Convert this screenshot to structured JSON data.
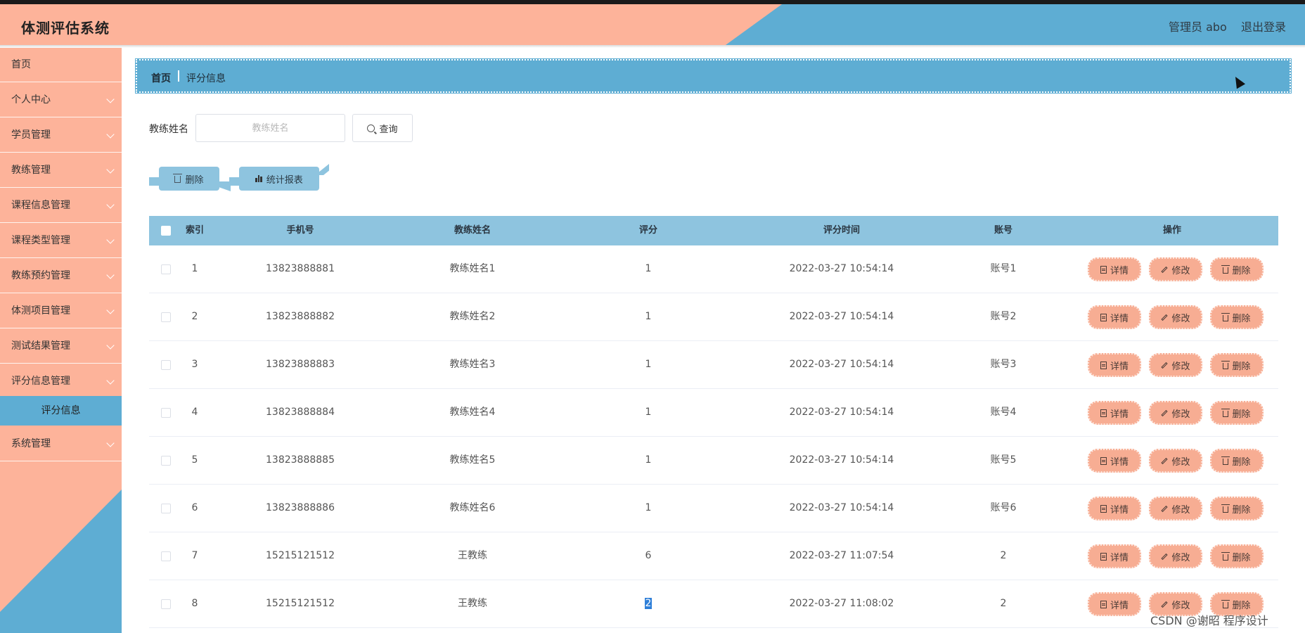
{
  "app": {
    "title": "体测评估系统"
  },
  "header": {
    "admin_label": "管理员 abo",
    "logout_label": "退出登录"
  },
  "sidebar": {
    "items": [
      {
        "label": "首页",
        "has_children": false
      },
      {
        "label": "个人中心",
        "has_children": true
      },
      {
        "label": "学员管理",
        "has_children": true
      },
      {
        "label": "教练管理",
        "has_children": true
      },
      {
        "label": "课程信息管理",
        "has_children": true
      },
      {
        "label": "课程类型管理",
        "has_children": true
      },
      {
        "label": "教练预约管理",
        "has_children": true
      },
      {
        "label": "体测项目管理",
        "has_children": true
      },
      {
        "label": "测试结果管理",
        "has_children": true
      },
      {
        "label": "评分信息管理",
        "has_children": true
      },
      {
        "label": "评分信息",
        "active_sub": true
      },
      {
        "label": "系统管理",
        "has_children": true
      }
    ]
  },
  "breadcrumb": {
    "home": "首页",
    "current": "评分信息"
  },
  "search": {
    "label": "教练姓名",
    "placeholder": "教练姓名",
    "value": "",
    "button_label": "查询"
  },
  "toolbar": {
    "delete_label": "删除",
    "report_label": "统计报表"
  },
  "table": {
    "headers": {
      "index": "索引",
      "phone": "手机号",
      "coach": "教练姓名",
      "score": "评分",
      "time": "评分时间",
      "account": "账号",
      "ops": "操作"
    },
    "actions": {
      "detail": "详情",
      "edit": "修改",
      "delete": "删除"
    },
    "rows": [
      {
        "index": "1",
        "phone": "13823888881",
        "coach": "教练姓名1",
        "score": "1",
        "time": "2022-03-27 10:54:14",
        "account": "账号1"
      },
      {
        "index": "2",
        "phone": "13823888882",
        "coach": "教练姓名2",
        "score": "1",
        "time": "2022-03-27 10:54:14",
        "account": "账号2"
      },
      {
        "index": "3",
        "phone": "13823888883",
        "coach": "教练姓名3",
        "score": "1",
        "time": "2022-03-27 10:54:14",
        "account": "账号3"
      },
      {
        "index": "4",
        "phone": "13823888884",
        "coach": "教练姓名4",
        "score": "1",
        "time": "2022-03-27 10:54:14",
        "account": "账号4"
      },
      {
        "index": "5",
        "phone": "13823888885",
        "coach": "教练姓名5",
        "score": "1",
        "time": "2022-03-27 10:54:14",
        "account": "账号5"
      },
      {
        "index": "6",
        "phone": "13823888886",
        "coach": "教练姓名6",
        "score": "1",
        "time": "2022-03-27 10:54:14",
        "account": "账号6"
      },
      {
        "index": "7",
        "phone": "15215121512",
        "coach": "王教练",
        "score": "6",
        "time": "2022-03-27 11:07:54",
        "account": "2"
      },
      {
        "index": "8",
        "phone": "15215121512",
        "coach": "王教练",
        "score": "2",
        "time": "2022-03-27 11:08:02",
        "account": "2"
      }
    ]
  },
  "watermark": "CSDN @谢昭  程序设计",
  "colors": {
    "salmon": "#fdb39a",
    "blue": "#5eadd3",
    "light_blue": "#8ec4df",
    "op_button": "#f7ad93"
  }
}
